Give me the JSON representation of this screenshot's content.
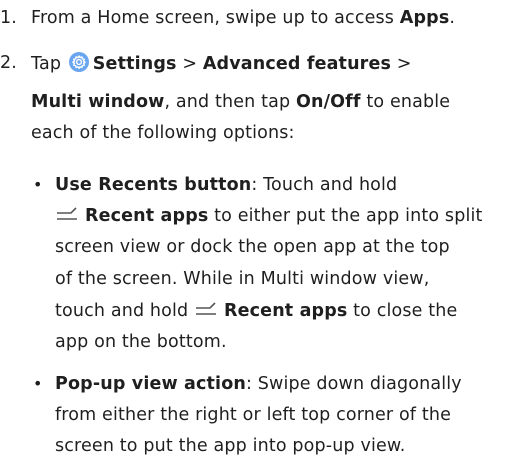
{
  "step1": {
    "number": "1.",
    "text": "From a Home screen, swipe up to access ",
    "apps": "Apps",
    "end": "."
  },
  "step2": {
    "number": "2.",
    "tap": "Tap",
    "settings": "Settings",
    "sep1": " > ",
    "advanced": "Advanced features",
    "sep2": " >",
    "multi_window": "Multi window",
    "then_tap": ", and then tap ",
    "onoff": "On/Off",
    "to_enable": " to enable",
    "line3": "each of the following options:"
  },
  "options": [
    {
      "bullet": "•",
      "title": "Use Recents button",
      "colon_text": ": Touch and hold",
      "recent_apps_1": "Recent apps",
      "line2_rest": " to either put the app into split",
      "line3": "screen view or dock the open app at the top",
      "line4": "of the screen. While in Multi window view,",
      "line5_pre": "touch and hold ",
      "recent_apps_2": "Recent apps",
      "line5_post": " to close the",
      "line6": "app on the bottom."
    },
    {
      "bullet": "•",
      "title": "Pop-up view action",
      "colon_text": ": Swipe down diagonally",
      "line2": "from either the right or left top corner of the",
      "line3": "screen to put the app into pop-up view."
    }
  ],
  "icons": {
    "settings": "settings-gear-icon",
    "recent": "recent-apps-icon",
    "settings_color": "#6aa6f0"
  }
}
